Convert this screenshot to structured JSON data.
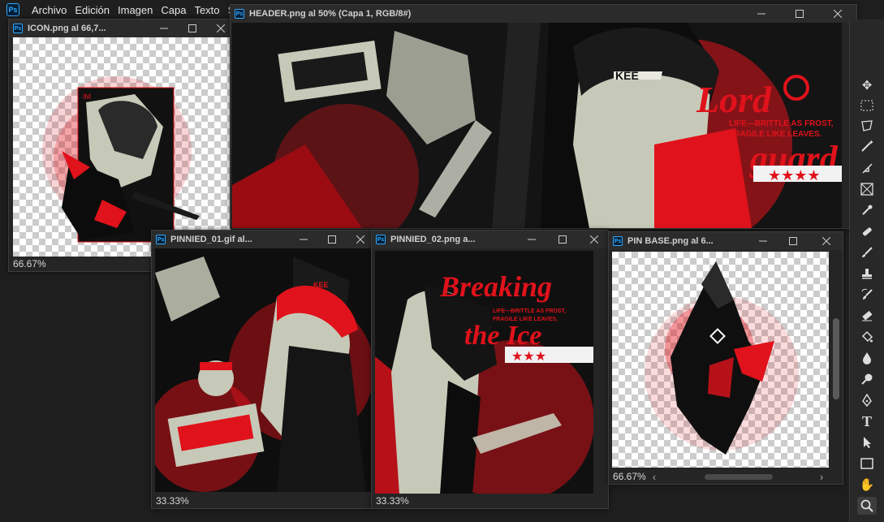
{
  "app": {
    "logo": "Ps"
  },
  "menu": [
    "Archivo",
    "Edición",
    "Imagen",
    "Capa",
    "Texto",
    "Sel"
  ],
  "windows": {
    "icon": {
      "title": "ICON.png al 66,7...",
      "zoom": "66.67%"
    },
    "header": {
      "title": "HEADER.png al 50% (Capa 1, RGB/8#)"
    },
    "pinnied01": {
      "title": "PINNIED_01.gif al...",
      "zoom": "33.33%"
    },
    "pinnied02": {
      "title": "PINNIED_02.png a...",
      "zoom": "33.33%"
    },
    "pinbase": {
      "title": "PIN BASE.png al 6...",
      "zoom": "66.67%"
    }
  },
  "artwork": {
    "header_title_1": "Lord",
    "header_title_2": "guard",
    "header_sub_1": "LIFE—BRITTLE AS FROST,",
    "header_sub_2": "FRAGILE  LIKE  LEAVES.",
    "header_stars": "★★★★",
    "hat_text": "KEE",
    "pin02_title_1": "Breaking",
    "pin02_title_2": "the Ice",
    "pin02_sub_1": "LIFE—BRITTLE AS FROST,",
    "pin02_sub_2": "FRAGILE  LIKE  LEAVES.",
    "pin02_stars": "★★★",
    "pin01_hat": "KEE"
  },
  "tools": [
    "move-icon",
    "marquee-icon",
    "lasso-icon",
    "magic-wand-icon",
    "crop-icon",
    "frame-icon",
    "eyedropper-icon",
    "healing-brush-icon",
    "brush-icon",
    "clone-stamp-icon",
    "history-brush-icon",
    "eraser-icon",
    "paint-bucket-icon",
    "blur-icon",
    "dodge-icon",
    "pen-icon",
    "type-icon",
    "path-select-icon",
    "rectangle-icon",
    "hand-icon",
    "zoom-icon"
  ],
  "colors": {
    "accent_red": "#e0121b",
    "ps_blue": "#31a8ff",
    "chrome": "#2b2b2b"
  }
}
